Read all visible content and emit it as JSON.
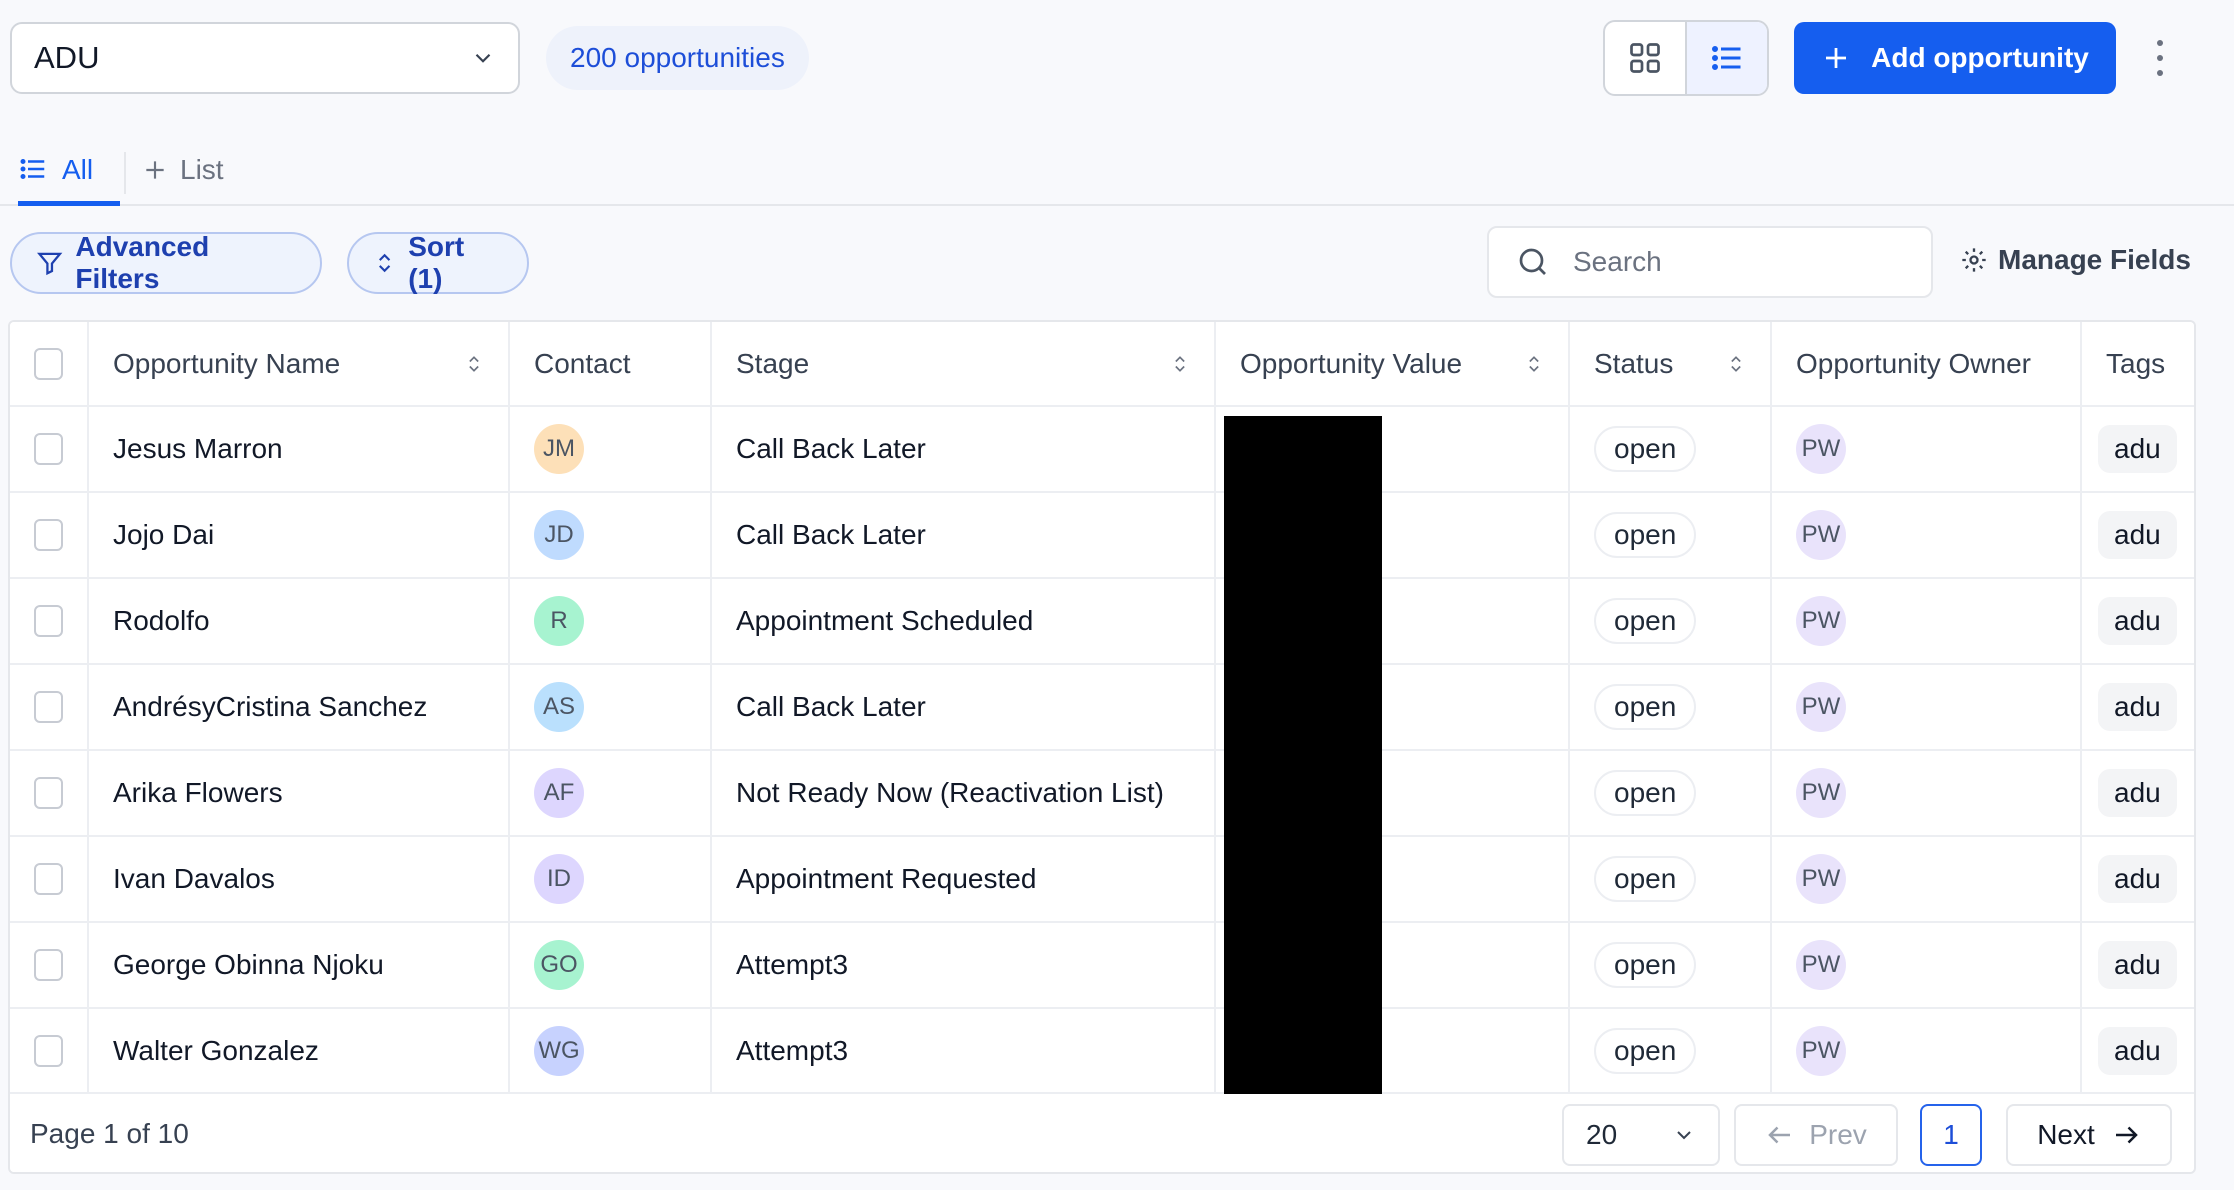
{
  "pipeline_select": {
    "value": "ADU"
  },
  "count_badge": "200 opportunities",
  "add_button": "Add opportunity",
  "tabs": {
    "all": "All",
    "add_list": "List"
  },
  "toolbar": {
    "advanced_filters": "Advanced Filters",
    "sort": "Sort (1)",
    "search_placeholder": "Search",
    "manage_fields": "Manage Fields"
  },
  "table": {
    "columns": [
      "Opportunity Name",
      "Contact",
      "Stage",
      "Opportunity Value",
      "Status",
      "Opportunity Owner",
      "Tags"
    ],
    "rows": [
      {
        "name": "Jesus Marron",
        "initials": "JM",
        "avatar_color": "#fde0b8",
        "stage": "Call Back Later",
        "status": "open",
        "owner": "PW",
        "tag": "adu"
      },
      {
        "name": "Jojo Dai",
        "initials": "JD",
        "avatar_color": "#bfdbfe",
        "stage": "Call Back Later",
        "status": "open",
        "owner": "PW",
        "tag": "adu"
      },
      {
        "name": "Rodolfo",
        "initials": "R",
        "avatar_color": "#a7f3d0",
        "stage": "Appointment Scheduled",
        "status": "open",
        "owner": "PW",
        "tag": "adu"
      },
      {
        "name": "AndrésyCristina Sanchez",
        "initials": "AS",
        "avatar_color": "#bae0fd",
        "stage": "Call Back Later",
        "status": "open",
        "owner": "PW",
        "tag": "adu"
      },
      {
        "name": "Arika Flowers",
        "initials": "AF",
        "avatar_color": "#ddd6fe",
        "stage": "Not Ready Now (Reactivation List)",
        "status": "open",
        "owner": "PW",
        "tag": "adu"
      },
      {
        "name": "Ivan Davalos",
        "initials": "ID",
        "avatar_color": "#ddd6fe",
        "stage": "Appointment Requested",
        "status": "open",
        "owner": "PW",
        "tag": "adu"
      },
      {
        "name": "George Obinna Njoku",
        "initials": "GO",
        "avatar_color": "#a7f3d0",
        "stage": "Attempt3",
        "status": "open",
        "owner": "PW",
        "tag": "adu"
      },
      {
        "name": "Walter Gonzalez",
        "initials": "WG",
        "avatar_color": "#c7d2fe",
        "stage": "Attempt3",
        "status": "open",
        "owner": "PW",
        "tag": "adu"
      }
    ]
  },
  "footer": {
    "page_label": "Page 1 of 10",
    "page_size": "20",
    "prev": "Prev",
    "current_page": "1",
    "next": "Next"
  },
  "colors": {
    "accent": "#155eef",
    "owner_avatar": "#e9e3fb"
  }
}
